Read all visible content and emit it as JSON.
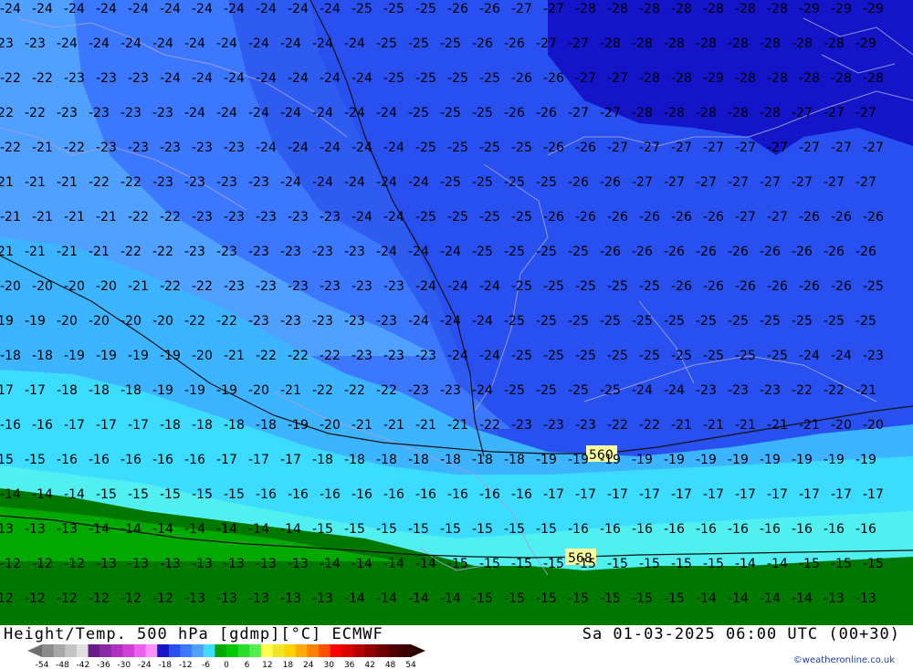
{
  "map": {
    "variable_label": "Height/Temp. 500 hPa [gdmp][°C] ECMWF",
    "valid_time": "Sa 01-03-2025 06:00 UTC (00+30)",
    "credit": "©weatheronline.co.uk",
    "height_contours": [
      {
        "label": "560"
      },
      {
        "label": "568"
      }
    ],
    "temperature_rows": [
      {
        "values": [
          "-24",
          "-24",
          "-24",
          "-24",
          "-24",
          "-24",
          "-24",
          "-24",
          "-24",
          "-24",
          "-24",
          "-25",
          "-25",
          "-25",
          "-26",
          "-26",
          "-27",
          "-27",
          "-28",
          "-28",
          "-28",
          "-28",
          "-28",
          "-28",
          "-28",
          "-29",
          "-29",
          "-29"
        ]
      },
      {
        "values": [
          "-23",
          "-23",
          "-24",
          "-24",
          "-24",
          "-24",
          "-24",
          "-24",
          "-24",
          "-24",
          "-24",
          "-24",
          "-25",
          "-25",
          "-25",
          "-26",
          "-26",
          "-27",
          "-27",
          "-28",
          "-28",
          "-28",
          "-28",
          "-28",
          "-28",
          "-28",
          "-28",
          "-29",
          "-29"
        ]
      },
      {
        "values": [
          "-22",
          "-22",
          "-23",
          "-23",
          "-23",
          "-24",
          "-24",
          "-24",
          "-24",
          "-24",
          "-24",
          "-24",
          "-25",
          "-25",
          "-25",
          "-25",
          "-26",
          "-26",
          "-27",
          "-27",
          "-28",
          "-28",
          "-29",
          "-28",
          "-28",
          "-28",
          "-28",
          "-28",
          "-28"
        ]
      },
      {
        "values": [
          "-22",
          "-22",
          "-23",
          "-23",
          "-23",
          "-23",
          "-24",
          "-24",
          "-24",
          "-24",
          "-24",
          "-24",
          "-24",
          "-25",
          "-25",
          "-25",
          "-26",
          "-26",
          "-27",
          "-27",
          "-28",
          "-28",
          "-28",
          "-28",
          "-28",
          "-27",
          "-27",
          "-27",
          "-27"
        ]
      },
      {
        "values": [
          "-22",
          "-21",
          "-22",
          "-23",
          "-23",
          "-23",
          "-23",
          "-23",
          "-24",
          "-24",
          "-24",
          "-24",
          "-24",
          "-25",
          "-25",
          "-25",
          "-25",
          "-26",
          "-26",
          "-27",
          "-27",
          "-27",
          "-27",
          "-27",
          "-27",
          "-27",
          "-27",
          "-27",
          "-27"
        ]
      },
      {
        "values": [
          "-21",
          "-21",
          "-21",
          "-22",
          "-22",
          "-23",
          "-23",
          "-23",
          "-23",
          "-24",
          "-24",
          "-24",
          "-24",
          "-24",
          "-25",
          "-25",
          "-25",
          "-25",
          "-26",
          "-26",
          "-27",
          "-27",
          "-27",
          "-27",
          "-27",
          "-27",
          "-27",
          "-27",
          "-26"
        ]
      },
      {
        "values": [
          "-21",
          "-21",
          "-21",
          "-21",
          "-22",
          "-22",
          "-23",
          "-23",
          "-23",
          "-23",
          "-23",
          "-24",
          "-24",
          "-25",
          "-25",
          "-25",
          "-25",
          "-26",
          "-26",
          "-26",
          "-26",
          "-26",
          "-26",
          "-27",
          "-27",
          "-26",
          "-26",
          "-26",
          "-26"
        ]
      },
      {
        "values": [
          "-21",
          "-21",
          "-21",
          "-21",
          "-22",
          "-22",
          "-23",
          "-23",
          "-23",
          "-23",
          "-23",
          "-23",
          "-24",
          "-24",
          "-24",
          "-25",
          "-25",
          "-25",
          "-25",
          "-26",
          "-26",
          "-26",
          "-26",
          "-26",
          "-26",
          "-26",
          "-26",
          "-26",
          "-26"
        ]
      },
      {
        "values": [
          "-20",
          "-20",
          "-20",
          "-20",
          "-21",
          "-22",
          "-22",
          "-23",
          "-23",
          "-23",
          "-23",
          "-23",
          "-23",
          "-24",
          "-24",
          "-24",
          "-25",
          "-25",
          "-25",
          "-25",
          "-25",
          "-26",
          "-26",
          "-26",
          "-26",
          "-26",
          "-26",
          "-25",
          "-25"
        ]
      },
      {
        "values": [
          "-19",
          "-19",
          "-20",
          "-20",
          "-20",
          "-20",
          "-22",
          "-22",
          "-23",
          "-23",
          "-23",
          "-23",
          "-23",
          "-24",
          "-24",
          "-24",
          "-25",
          "-25",
          "-25",
          "-25",
          "-25",
          "-25",
          "-25",
          "-25",
          "-25",
          "-25",
          "-25",
          "-25",
          "-25"
        ]
      },
      {
        "values": [
          "-18",
          "-18",
          "-19",
          "-19",
          "-19",
          "-19",
          "-20",
          "-21",
          "-22",
          "-22",
          "-22",
          "-23",
          "-23",
          "-23",
          "-24",
          "-24",
          "-25",
          "-25",
          "-25",
          "-25",
          "-25",
          "-25",
          "-25",
          "-25",
          "-25",
          "-24",
          "-24",
          "-23",
          "-23"
        ]
      },
      {
        "values": [
          "-17",
          "-17",
          "-18",
          "-18",
          "-18",
          "-19",
          "-19",
          "-19",
          "-20",
          "-21",
          "-22",
          "-22",
          "-22",
          "-23",
          "-23",
          "-24",
          "-25",
          "-25",
          "-25",
          "-25",
          "-24",
          "-24",
          "-23",
          "-23",
          "-23",
          "-22",
          "-22",
          "-21",
          "-21"
        ]
      },
      {
        "values": [
          "-16",
          "-16",
          "-17",
          "-17",
          "-17",
          "-18",
          "-18",
          "-18",
          "-18",
          "-19",
          "-20",
          "-21",
          "-21",
          "-21",
          "-21",
          "-22",
          "-23",
          "-23",
          "-23",
          "-22",
          "-22",
          "-21",
          "-21",
          "-21",
          "-21",
          "-21",
          "-20",
          "-20",
          "-20"
        ]
      },
      {
        "values": [
          "-15",
          "-15",
          "-16",
          "-16",
          "-16",
          "-16",
          "-16",
          "-17",
          "-17",
          "-17",
          "-18",
          "-18",
          "-18",
          "-18",
          "-18",
          "-18",
          "-18",
          "-19",
          "-19",
          "-19",
          "-19",
          "-19",
          "-19",
          "-19",
          "-19",
          "-19",
          "-19",
          "-19",
          "-18"
        ]
      },
      {
        "values": [
          "-14",
          "-14",
          "-14",
          "-15",
          "-15",
          "-15",
          "-15",
          "-15",
          "-16",
          "-16",
          "-16",
          "-16",
          "-16",
          "-16",
          "-16",
          "-16",
          "-16",
          "-17",
          "-17",
          "-17",
          "-17",
          "-17",
          "-17",
          "-17",
          "-17",
          "-17",
          "-17",
          "-17",
          "-17"
        ]
      },
      {
        "values": [
          "-13",
          "-13",
          "-13",
          "-14",
          "-14",
          "-14",
          "-14",
          "-14",
          "-14",
          "-14",
          "-15",
          "-15",
          "-15",
          "-15",
          "-15",
          "-15",
          "-15",
          "-15",
          "-16",
          "-16",
          "-16",
          "-16",
          "-16",
          "-16",
          "-16",
          "-16",
          "-16",
          "-16",
          "-16"
        ]
      },
      {
        "values": [
          "-12",
          "-12",
          "-12",
          "-13",
          "-13",
          "-13",
          "-13",
          "-13",
          "-13",
          "-13",
          "-14",
          "-14",
          "-14",
          "-14",
          "-15",
          "-15",
          "-15",
          "-15",
          "-15",
          "-15",
          "-15",
          "-15",
          "-15",
          "-14",
          "-14",
          "-15",
          "-15",
          "-15",
          "-15"
        ]
      },
      {
        "values": [
          "-12",
          "-12",
          "-12",
          "-12",
          "-12",
          "-12",
          "-13",
          "-13",
          "-13",
          "-13",
          "-13",
          "-14",
          "-14",
          "-14",
          "-14",
          "-15",
          "-15",
          "-15",
          "-15",
          "-15",
          "-15",
          "-15",
          "-14",
          "-14",
          "-14",
          "-14",
          "-13",
          "-13",
          "-13"
        ]
      }
    ]
  },
  "legend": {
    "ticks": [
      "-54",
      "-48",
      "-42",
      "-36",
      "-30",
      "-24",
      "-18",
      "-12",
      "-6",
      "0",
      "6",
      "12",
      "18",
      "24",
      "30",
      "36",
      "42",
      "48",
      "54"
    ],
    "colors": [
      "#8c8c8c",
      "#a8a8a8",
      "#c4c4c4",
      "#e0e0e0",
      "#6a1a8a",
      "#8a28a6",
      "#b030c0",
      "#d040d8",
      "#f060f0",
      "#ff90ff",
      "#1414c8",
      "#2850f0",
      "#3c78ff",
      "#50a0ff",
      "#3cdcff",
      "#00a800",
      "#00c800",
      "#28dc28",
      "#50f050",
      "#ffff50",
      "#f0e628",
      "#ffd200",
      "#ffaa00",
      "#ff8000",
      "#ff5000",
      "#ff0000",
      "#dc0000",
      "#b40000",
      "#900000",
      "#700000",
      "#500000",
      "#3c0000"
    ]
  }
}
